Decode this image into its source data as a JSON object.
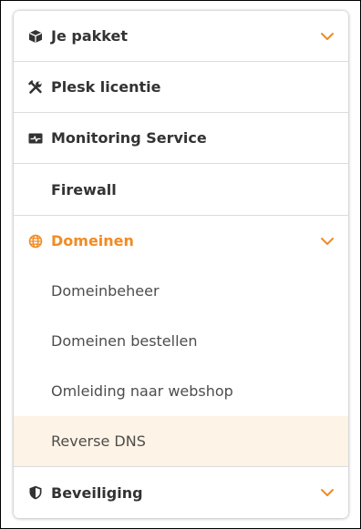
{
  "colors": {
    "accent": "#f28b22",
    "selected_bg": "#fdf3e6",
    "text": "#333333"
  },
  "menu": {
    "je_pakket": {
      "label": "Je pakket",
      "icon": "box-icon"
    },
    "plesk": {
      "label": "Plesk licentie",
      "icon": "tools-icon"
    },
    "monitoring": {
      "label": "Monitoring Service",
      "icon": "monitor-pulse-icon"
    },
    "firewall": {
      "label": "Firewall"
    },
    "domeinen": {
      "label": "Domeinen",
      "icon": "globe-icon",
      "items": [
        {
          "label": "Domeinbeheer"
        },
        {
          "label": "Domeinen bestellen"
        },
        {
          "label": "Omleiding naar webshop"
        },
        {
          "label": "Reverse DNS",
          "selected": true
        }
      ]
    },
    "beveiliging": {
      "label": "Beveiliging",
      "icon": "shield-icon"
    }
  }
}
